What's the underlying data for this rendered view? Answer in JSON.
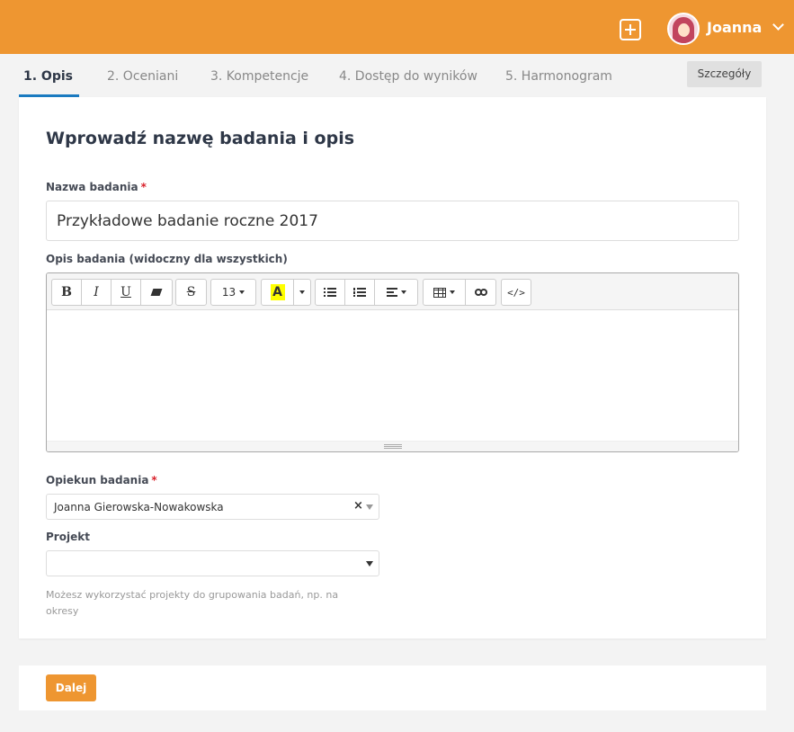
{
  "colors": {
    "brand": "#ee9631",
    "accent": "#1a7ac0"
  },
  "header": {
    "add_icon": "plus-square-icon",
    "user_name": "Joanna",
    "user_menu_icon": "chevron-down-icon"
  },
  "tabs": [
    {
      "label": "1. Opis",
      "active": true
    },
    {
      "label": "2. Oceniani"
    },
    {
      "label": "3. Kompetencje"
    },
    {
      "label": "4. Dostęp do wyników"
    },
    {
      "label": "5. Harmonogram"
    }
  ],
  "details_button": "Szczegóły",
  "form": {
    "heading": "Wprowadź nazwę badania i opis",
    "name_label": "Nazwa badania",
    "required_mark": "*",
    "name_value": "Przykładowe badanie roczne 2017",
    "description_label": "Opis badania (widoczny dla wszystkich)",
    "editor": {
      "bold": "B",
      "italic": "I",
      "underline": "U",
      "strike": "S",
      "font_size": "13",
      "highlight": "A",
      "code": "</>"
    },
    "owner_label": "Opiekun badania",
    "owner_value": "Joanna Gierowska-Nowakowska",
    "clear_symbol": "×",
    "project_label": "Projekt",
    "project_value": "",
    "project_help": "Możesz wykorzystać projekty do grupowania badań, np. na okresy"
  },
  "next_button": "Dalej"
}
